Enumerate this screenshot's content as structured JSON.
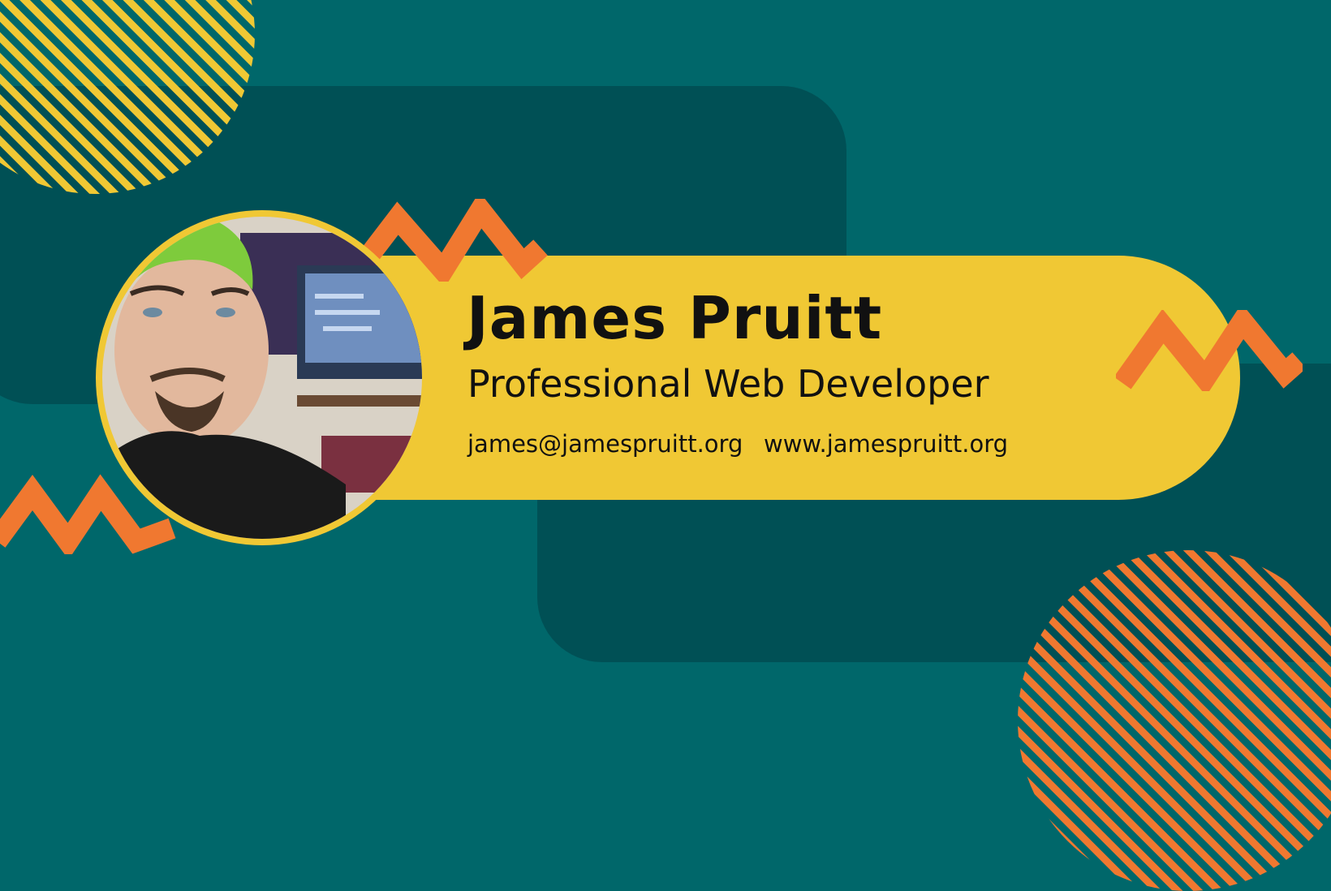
{
  "profile": {
    "name": "James Pruitt",
    "title": "Professional Web Developer",
    "email": "james@jamespruitt.org",
    "website": "www.jamespruitt.org"
  },
  "colors": {
    "background": "#00676a",
    "panel": "#005055",
    "banner": "#f0c834",
    "accent_orange": "#f07830",
    "text": "#111111"
  }
}
